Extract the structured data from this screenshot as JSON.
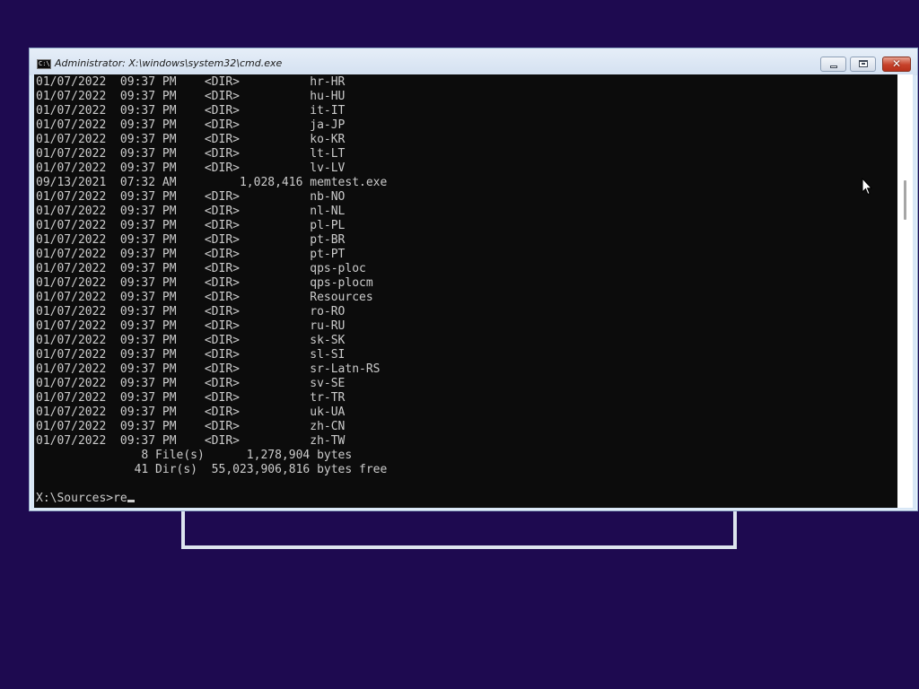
{
  "window": {
    "title": "Administrator: X:\\windows\\system32\\cmd.exe",
    "icon_label": "C:\\",
    "buttons": {
      "minimize": "minimize",
      "maximize": "restore",
      "close": "✕"
    }
  },
  "console": {
    "lines": [
      "01/07/2022  09:37 PM    <DIR>          hr-HR",
      "01/07/2022  09:37 PM    <DIR>          hu-HU",
      "01/07/2022  09:37 PM    <DIR>          it-IT",
      "01/07/2022  09:37 PM    <DIR>          ja-JP",
      "01/07/2022  09:37 PM    <DIR>          ko-KR",
      "01/07/2022  09:37 PM    <DIR>          lt-LT",
      "01/07/2022  09:37 PM    <DIR>          lv-LV",
      "09/13/2021  07:32 AM         1,028,416 memtest.exe",
      "01/07/2022  09:37 PM    <DIR>          nb-NO",
      "01/07/2022  09:37 PM    <DIR>          nl-NL",
      "01/07/2022  09:37 PM    <DIR>          pl-PL",
      "01/07/2022  09:37 PM    <DIR>          pt-BR",
      "01/07/2022  09:37 PM    <DIR>          pt-PT",
      "01/07/2022  09:37 PM    <DIR>          qps-ploc",
      "01/07/2022  09:37 PM    <DIR>          qps-plocm",
      "01/07/2022  09:37 PM    <DIR>          Resources",
      "01/07/2022  09:37 PM    <DIR>          ro-RO",
      "01/07/2022  09:37 PM    <DIR>          ru-RU",
      "01/07/2022  09:37 PM    <DIR>          sk-SK",
      "01/07/2022  09:37 PM    <DIR>          sl-SI",
      "01/07/2022  09:37 PM    <DIR>          sr-Latn-RS",
      "01/07/2022  09:37 PM    <DIR>          sv-SE",
      "01/07/2022  09:37 PM    <DIR>          tr-TR",
      "01/07/2022  09:37 PM    <DIR>          uk-UA",
      "01/07/2022  09:37 PM    <DIR>          zh-CN",
      "01/07/2022  09:37 PM    <DIR>          zh-TW",
      "               8 File(s)      1,278,904 bytes",
      "              41 Dir(s)  55,023,906,816 bytes free"
    ],
    "prompt": "X:\\Sources>",
    "input": "re"
  },
  "colors": {
    "desktop_background": "#1e0a50",
    "console_background": "#0c0c0c",
    "console_text": "#cccccc",
    "close_button": "#c6412a"
  },
  "icons": [
    "cmd-app-icon",
    "minimize-icon",
    "restore-icon",
    "close-icon",
    "mouse-pointer-icon"
  ]
}
